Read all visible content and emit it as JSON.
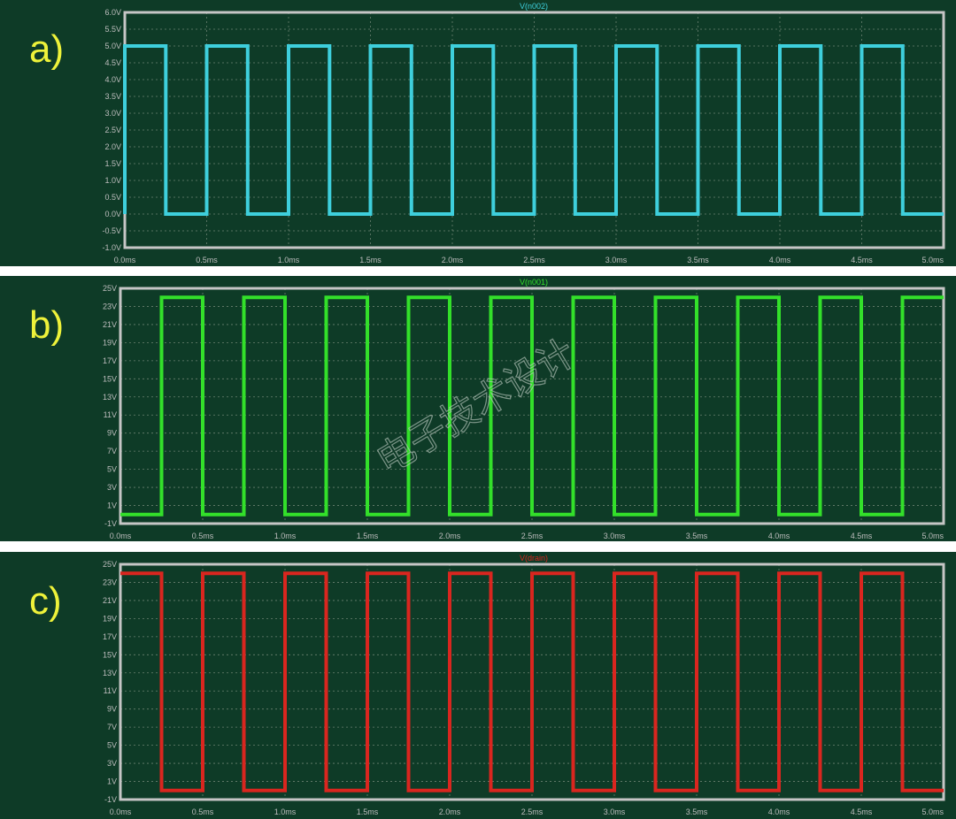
{
  "watermark": "电子技术设计",
  "chart_data": [
    {
      "type": "line",
      "panel_label": "a)",
      "title": "V(n002)",
      "color": "#3ecfdc",
      "xlabel": "",
      "ylabel": "",
      "xlim": [
        0,
        5
      ],
      "ylim": [
        -1,
        6
      ],
      "x_ticks": [
        0,
        0.5,
        1,
        1.5,
        2,
        2.5,
        3,
        3.5,
        4,
        4.5,
        5
      ],
      "x_tick_labels": [
        "0.0ms",
        "0.5ms",
        "1.0ms",
        "1.5ms",
        "2.0ms",
        "2.5ms",
        "3.0ms",
        "3.5ms",
        "4.0ms",
        "4.5ms",
        "5.0ms"
      ],
      "y_ticks": [
        -1,
        -0.5,
        0,
        0.5,
        1,
        1.5,
        2,
        2.5,
        3,
        3.5,
        4,
        4.5,
        5,
        5.5,
        6
      ],
      "y_tick_labels": [
        "-1.0V",
        "-0.5V",
        "0.0V",
        "0.5V",
        "1.0V",
        "1.5V",
        "2.0V",
        "2.5V",
        "3.0V",
        "3.5V",
        "4.0V",
        "4.5V",
        "5.0V",
        "5.5V",
        "6.0V"
      ],
      "grid": true,
      "series": [
        {
          "x": [
            0,
            0,
            0.25,
            0.25,
            0.5,
            0.5,
            0.75,
            0.75,
            1,
            1,
            1.25,
            1.25,
            1.5,
            1.5,
            1.75,
            1.75,
            2,
            2,
            2.25,
            2.25,
            2.5,
            2.5,
            2.75,
            2.75,
            3,
            3,
            3.25,
            3.25,
            3.5,
            3.5,
            3.75,
            3.75,
            4,
            4,
            4.25,
            4.25,
            4.5,
            4.5,
            4.75,
            4.75,
            5
          ],
          "y": [
            0,
            5,
            5,
            0,
            0,
            5,
            5,
            0,
            0,
            5,
            5,
            0,
            0,
            5,
            5,
            0,
            0,
            5,
            5,
            0,
            0,
            5,
            5,
            0,
            0,
            5,
            5,
            0,
            0,
            5,
            5,
            0,
            0,
            5,
            5,
            0,
            0,
            5,
            5,
            0,
            0
          ]
        }
      ]
    },
    {
      "type": "line",
      "panel_label": "b)",
      "title": "V(n001)",
      "color": "#33e02a",
      "xlabel": "",
      "ylabel": "",
      "xlim": [
        0,
        5
      ],
      "ylim": [
        -1,
        25
      ],
      "x_ticks": [
        0,
        0.5,
        1,
        1.5,
        2,
        2.5,
        3,
        3.5,
        4,
        4.5,
        5
      ],
      "x_tick_labels": [
        "0.0ms",
        "0.5ms",
        "1.0ms",
        "1.5ms",
        "2.0ms",
        "2.5ms",
        "3.0ms",
        "3.5ms",
        "4.0ms",
        "4.5ms",
        "5.0ms"
      ],
      "y_ticks": [
        -1,
        1,
        3,
        5,
        7,
        9,
        11,
        13,
        15,
        17,
        19,
        21,
        23,
        25
      ],
      "y_tick_labels": [
        "-1V",
        "1V",
        "3V",
        "5V",
        "7V",
        "9V",
        "11V",
        "13V",
        "15V",
        "17V",
        "19V",
        "21V",
        "23V",
        "25V"
      ],
      "grid": true,
      "series": [
        {
          "x": [
            0,
            0.25,
            0.25,
            0.5,
            0.5,
            0.75,
            0.75,
            1,
            1,
            1.25,
            1.25,
            1.5,
            1.5,
            1.75,
            1.75,
            2,
            2,
            2.25,
            2.25,
            2.5,
            2.5,
            2.75,
            2.75,
            3,
            3,
            3.25,
            3.25,
            3.5,
            3.5,
            3.75,
            3.75,
            4,
            4,
            4.25,
            4.25,
            4.5,
            4.5,
            4.75,
            4.75,
            5
          ],
          "y": [
            0,
            0,
            24,
            24,
            0,
            0,
            24,
            24,
            0,
            0,
            24,
            24,
            0,
            0,
            24,
            24,
            0,
            0,
            24,
            24,
            0,
            0,
            24,
            24,
            0,
            0,
            24,
            24,
            0,
            0,
            24,
            24,
            0,
            0,
            24,
            24,
            0,
            0,
            24,
            24
          ]
        }
      ]
    },
    {
      "type": "line",
      "panel_label": "c)",
      "title": "V(drain)",
      "color": "#d9261f",
      "xlabel": "",
      "ylabel": "",
      "xlim": [
        0,
        5
      ],
      "ylim": [
        -1,
        25
      ],
      "x_ticks": [
        0,
        0.5,
        1,
        1.5,
        2,
        2.5,
        3,
        3.5,
        4,
        4.5,
        5
      ],
      "x_tick_labels": [
        "0.0ms",
        "0.5ms",
        "1.0ms",
        "1.5ms",
        "2.0ms",
        "2.5ms",
        "3.0ms",
        "3.5ms",
        "4.0ms",
        "4.5ms",
        "5.0ms"
      ],
      "y_ticks": [
        -1,
        1,
        3,
        5,
        7,
        9,
        11,
        13,
        15,
        17,
        19,
        21,
        23,
        25
      ],
      "y_tick_labels": [
        "-1V",
        "1V",
        "3V",
        "5V",
        "7V",
        "9V",
        "11V",
        "13V",
        "15V",
        "17V",
        "19V",
        "21V",
        "23V",
        "25V"
      ],
      "grid": true,
      "series": [
        {
          "x": [
            0,
            0.25,
            0.25,
            0.5,
            0.5,
            0.75,
            0.75,
            1,
            1,
            1.25,
            1.25,
            1.5,
            1.5,
            1.75,
            1.75,
            2,
            2,
            2.25,
            2.25,
            2.5,
            2.5,
            2.75,
            2.75,
            3,
            3,
            3.25,
            3.25,
            3.5,
            3.5,
            3.75,
            3.75,
            4,
            4,
            4.25,
            4.25,
            4.5,
            4.5,
            4.75,
            4.75,
            5
          ],
          "y": [
            24,
            24,
            0,
            0,
            24,
            24,
            0,
            0,
            24,
            24,
            0,
            0,
            24,
            24,
            0,
            0,
            24,
            24,
            0,
            0,
            24,
            24,
            0,
            0,
            24,
            24,
            0,
            0,
            24,
            24,
            0,
            0,
            24,
            24,
            0,
            0,
            24,
            24,
            0,
            0
          ]
        }
      ]
    }
  ]
}
